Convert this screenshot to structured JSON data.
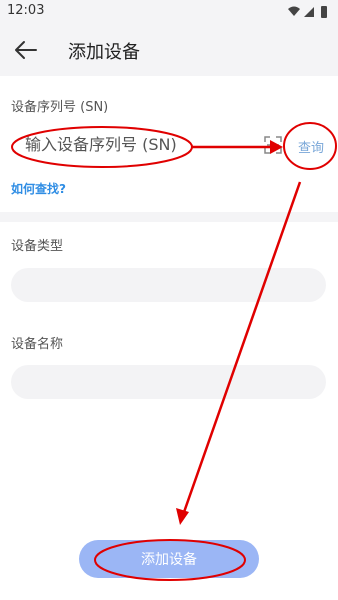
{
  "status_bar": {
    "time": "12:03"
  },
  "header": {
    "title": "添加设备",
    "back_icon": "arrow-left-icon"
  },
  "form": {
    "sn_label": "设备序列号 (SN)",
    "sn_placeholder": "输入设备序列号 (SN)",
    "scan_icon": "scan-icon",
    "query_label": "查询",
    "help_link": "如何查找?",
    "type_label": "设备类型",
    "name_label": "设备名称"
  },
  "actions": {
    "add_label": "添加设备"
  },
  "colors": {
    "accent": "#2f8de4",
    "button": "#9bb6f5",
    "annotation": "#e00000",
    "background_gray": "#f4f4f6"
  }
}
